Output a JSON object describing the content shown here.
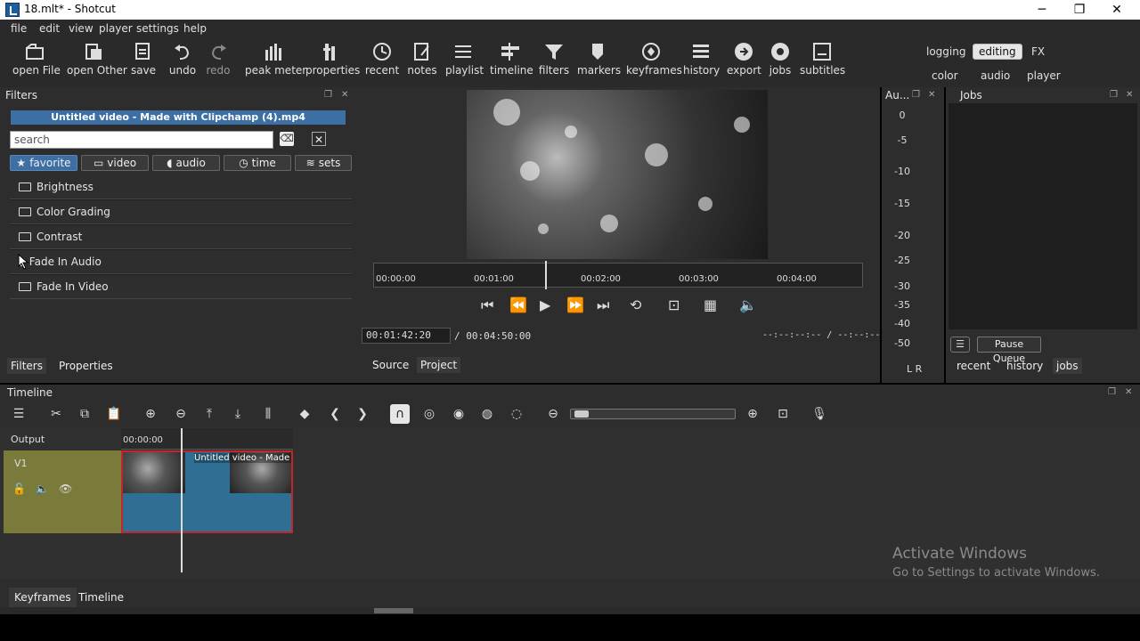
{
  "window": {
    "title": "18.mlt* - Shotcut",
    "min": "─",
    "max": "❐",
    "close": "✕"
  },
  "menu": [
    "file",
    "edit",
    "view",
    "player",
    "settings",
    "help"
  ],
  "toolbar": [
    {
      "label": "open File",
      "icon": "open-file-icon"
    },
    {
      "label": "open Other",
      "icon": "open-other-icon"
    },
    {
      "label": "save",
      "icon": "save-icon"
    },
    {
      "label": "undo",
      "icon": "undo-icon"
    },
    {
      "label": "redo",
      "icon": "redo-icon"
    },
    {
      "label": "peak meter",
      "icon": "peak-meter-icon"
    },
    {
      "label": "properties",
      "icon": "properties-icon"
    },
    {
      "label": "recent",
      "icon": "recent-icon"
    },
    {
      "label": "notes",
      "icon": "notes-icon"
    },
    {
      "label": "playlist",
      "icon": "playlist-icon"
    },
    {
      "label": "timeline",
      "icon": "timeline-icon"
    },
    {
      "label": "filters",
      "icon": "filters-icon"
    },
    {
      "label": "markers",
      "icon": "markers-icon"
    },
    {
      "label": "keyframes",
      "icon": "keyframes-icon"
    },
    {
      "label": "history",
      "icon": "history-icon"
    },
    {
      "label": "export",
      "icon": "export-icon"
    },
    {
      "label": "jobs",
      "icon": "jobs-icon"
    },
    {
      "label": "subtitles",
      "icon": "subtitles-icon"
    }
  ],
  "layouts": {
    "logging": "logging",
    "editing": "editing",
    "fx": "FX",
    "color": "color",
    "audio": "audio",
    "player": "player"
  },
  "filters": {
    "title": "Filters",
    "clip_name": "Untitled video - Made with Clipchamp (4).mp4",
    "search_placeholder": "search",
    "tabs": [
      "favorite",
      "video",
      "audio",
      "time",
      "sets"
    ],
    "items": [
      "Brightness",
      "Color Grading",
      "Contrast",
      "Fade In Audio",
      "Fade In Video"
    ],
    "bottom_tabs": [
      "Filters",
      "Properties"
    ]
  },
  "player": {
    "ruler_labels": [
      "00:00:00",
      "00:01:00",
      "00:02:00",
      "00:03:00",
      "00:04:00"
    ],
    "current_time": "00:01:42:20",
    "duration": "/ 00:04:50:00",
    "in_out": "--:--:--:-- / --:--:--:--",
    "source_tab": "Source",
    "project_tab": "Project"
  },
  "audio_meter": {
    "title": "Au...",
    "scale": [
      "0",
      "-5",
      "-10",
      "-15",
      "-20",
      "-25",
      "-30",
      "-35",
      "-40",
      "-50"
    ],
    "channels": "L R"
  },
  "jobs": {
    "title": "Jobs",
    "pause_queue": "Pause Queue",
    "tabs": [
      "recent",
      "history",
      "jobs"
    ]
  },
  "timeline": {
    "title": "Timeline",
    "output_label": "Output",
    "track_name": "V1",
    "ruler_start": "00:00:00",
    "clip_label": "Untitled video - Made w",
    "bottom_tabs": [
      "Keyframes",
      "Timeline"
    ]
  },
  "watermark": {
    "line1": "Activate Windows",
    "line2": "Go to Settings to activate Windows."
  }
}
